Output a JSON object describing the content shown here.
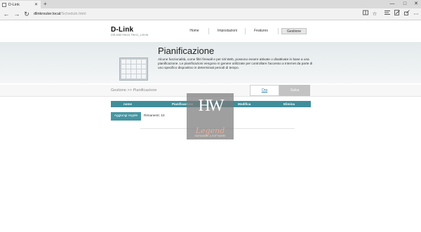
{
  "browser": {
    "tab_title": "D-Link",
    "tab_close": "✕",
    "new_tab": "+",
    "window_controls": {
      "minimize": "—",
      "maximize": "□",
      "close": "✕"
    },
    "nav": {
      "back": "←",
      "forward": "→",
      "refresh": "↻"
    },
    "url_host": "dlinkrouter.local",
    "url_path": "/Schedule.html",
    "toolbar_icons": [
      "reading-view-icon",
      "favorite-star-icon",
      "hub-icon",
      "note-icon",
      "share-icon",
      "more-icon"
    ]
  },
  "header": {
    "logo": "D-Link",
    "model": "DIR-3060  HW:A1  FW:01_1.09.06",
    "nav": [
      {
        "label": "Home"
      },
      {
        "label": "Impostazioni"
      },
      {
        "label": "Features"
      },
      {
        "label": "Gestione"
      }
    ]
  },
  "page": {
    "title": "Pianificazione",
    "description": "Alcune funzionalità, come filtri firewall e per siti Web, possono essere attivate o disattivate in base a una pianificazione. Le pianificazioni vengono in genere utilizzate per controllare l'accesso a Internet da parte di uno specifico dispositivo in determinati periodi di tempo.",
    "breadcrumb": "Gestione >> Pianificazione",
    "buttons": {
      "ora": "Ora",
      "salva": "Salva"
    }
  },
  "table": {
    "headers": [
      "nome",
      "Pianificazione",
      "Modifica",
      "Elimina"
    ],
    "add_button": "Aggiungi regole",
    "remaining_label": "Rimanenti: 10"
  },
  "watermark": {
    "hw": "HW",
    "legend": "Legend",
    "sub": "HARDWARE & SOFTWARE"
  },
  "colors": {
    "accent": "#3f8e9a",
    "link": "#2f7fa8",
    "watermark_legend": "#e3ae9c"
  }
}
